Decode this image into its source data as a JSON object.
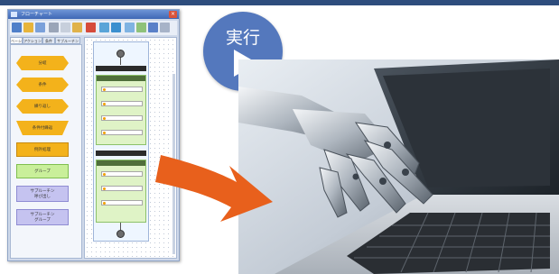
{
  "window": {
    "title": "フローチャート",
    "close_glyph": "×",
    "tabs": [
      "ベーシ",
      "アクション",
      "条件",
      "サブルーチン"
    ],
    "palette": [
      {
        "label": "分岐",
        "shape": "arrow"
      },
      {
        "label": "条件",
        "shape": "hex"
      },
      {
        "label": "繰り返し",
        "shape": "hex"
      },
      {
        "label": "条件付繰返",
        "shape": "funnel"
      },
      {
        "label": "例外処理",
        "shape": "rect-orange"
      },
      {
        "label": "グループ",
        "shape": "rect-green"
      },
      {
        "label": "サブルーチン\n呼び出し",
        "shape": "rect-lav"
      },
      {
        "label": "サブルーチン\nグループ",
        "shape": "rect-lav"
      }
    ],
    "flow": {
      "group_label": "グループ",
      "steps_group1": [
        "ファイル操作 (結果)",
        "文字列処理 (結果)",
        "クリック (結果)",
        "文字列処理 (結果)"
      ],
      "steps_group2": [
        "クリック (結果)",
        "文字列処理 (結果)",
        "クリック (結果)"
      ]
    }
  },
  "badge": {
    "label": "実行",
    "icon": "play-icon"
  },
  "photo": {
    "subject": "robot-hand-typing-on-laptop"
  },
  "arrow": {
    "color": "#e8601c"
  },
  "colors": {
    "topbar": "#2e4d7d",
    "badge": "#5478bd",
    "arrow": "#e8601c"
  }
}
